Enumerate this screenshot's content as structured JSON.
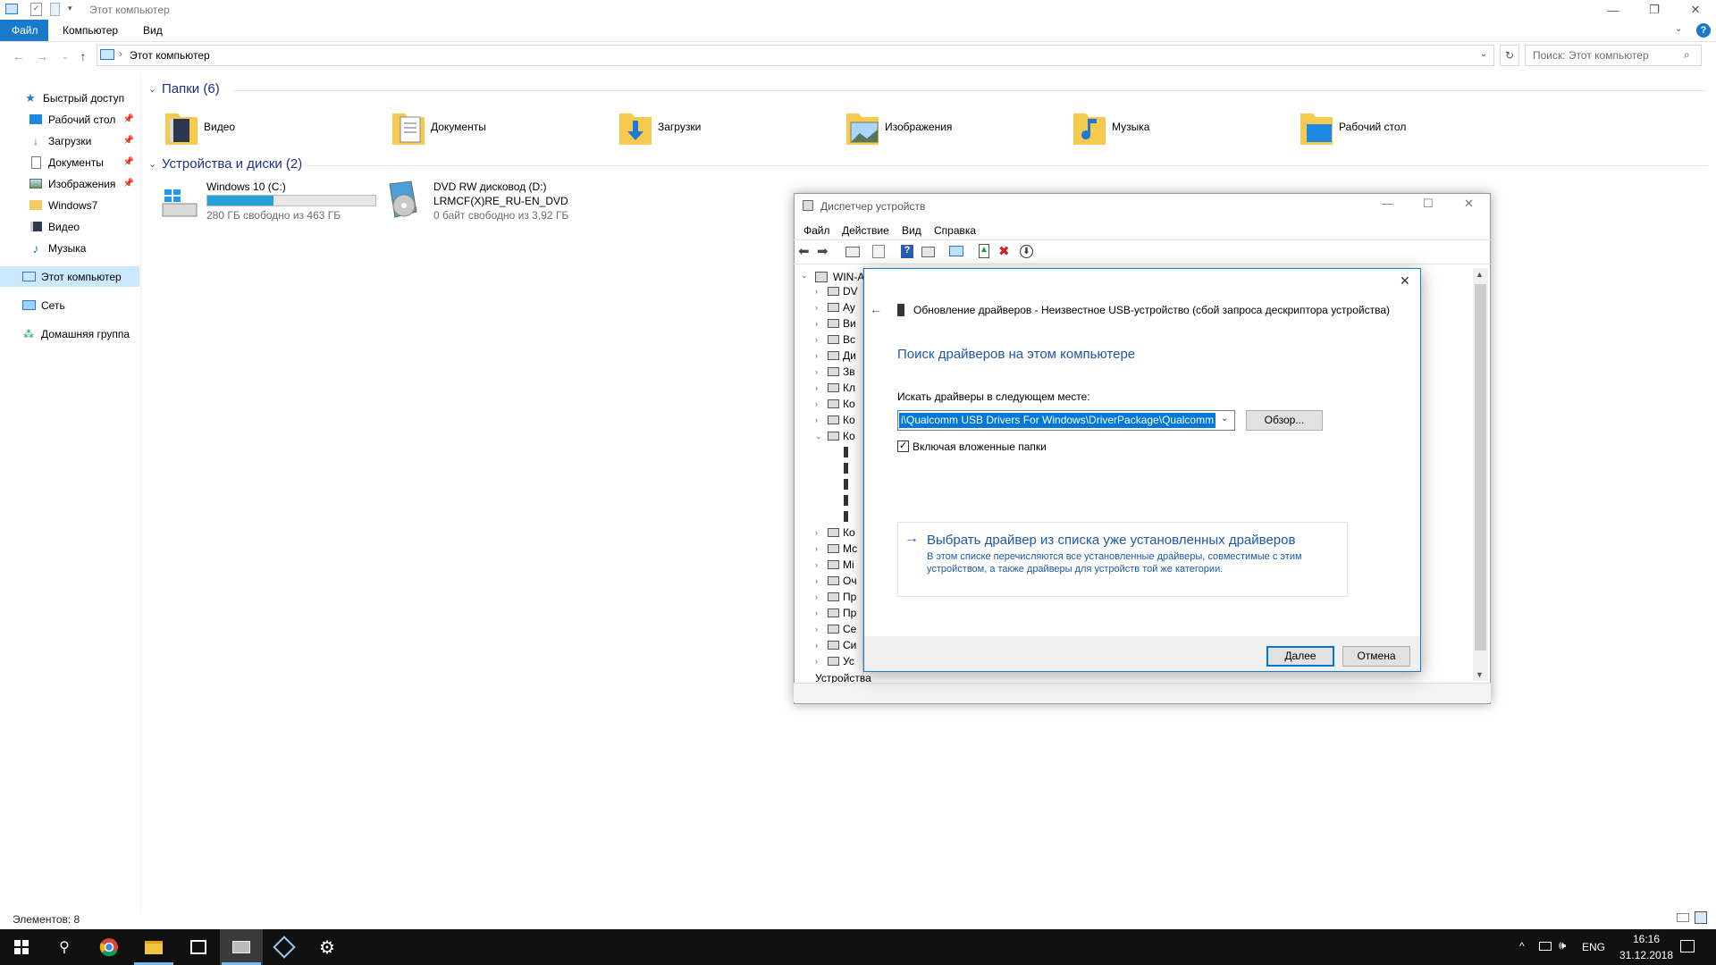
{
  "explorer": {
    "title": "Этот компьютер",
    "ribbon_tabs": [
      "Файл",
      "Компьютер",
      "Вид"
    ],
    "address": "Этот компьютер",
    "search_placeholder": "Поиск: Этот компьютер",
    "sidebar": [
      {
        "label": "Быстрый доступ",
        "icon": "star-icon",
        "color": "#2b79d4"
      },
      {
        "label": "Рабочий стол",
        "icon": "desktop-icon",
        "pinned": true
      },
      {
        "label": "Загрузки",
        "icon": "downloads-icon",
        "pinned": true
      },
      {
        "label": "Документы",
        "icon": "documents-icon",
        "pinned": true
      },
      {
        "label": "Изображения",
        "icon": "pictures-icon",
        "pinned": true
      },
      {
        "label": "Windows7",
        "icon": "folder-icon"
      },
      {
        "label": "Видео",
        "icon": "video-icon"
      },
      {
        "label": "Музыка",
        "icon": "music-icon"
      },
      {
        "label": "Этот компьютер",
        "icon": "computer-icon",
        "selected": true
      },
      {
        "label": "Сеть",
        "icon": "network-icon"
      },
      {
        "label": "Домашняя группа",
        "icon": "homegroup-icon"
      }
    ],
    "folders_header": "Папки (6)",
    "folders": [
      "Видео",
      "Документы",
      "Загрузки",
      "Изображения",
      "Музыка",
      "Рабочий стол"
    ],
    "devices_header": "Устройства и диски (2)",
    "drives": [
      {
        "name": "Windows 10 (C:)",
        "free": "280 ГБ свободно из 463 ГБ",
        "used_fraction": 0.395
      },
      {
        "name": "DVD RW дисковод (D:)",
        "label": "LRMCF(X)RE_RU-EN_DVD",
        "free": "0 байт свободно из 3,92 ГБ"
      }
    ],
    "status": "Элементов: 8"
  },
  "device_manager": {
    "title": "Диспетчер устройств",
    "menu": [
      "Файл",
      "Действие",
      "Вид",
      "Справка"
    ],
    "tree_root": "WIN-A",
    "tree_items": [
      "DV",
      "Ау",
      "Ви",
      "Вс",
      "Ди",
      "Зв",
      "Кл",
      "Ко",
      "Ко",
      "Ко",
      "",
      "",
      "",
      "",
      "",
      "Ко",
      "Мс",
      "Мі",
      "Оч",
      "Пр",
      "Пр",
      "Се",
      "Си",
      "Ус"
    ],
    "bottom_item": "Устройства обработки изображений"
  },
  "dialog": {
    "title": "Обновление драйверов - Неизвестное USB-устройство (сбой запроса дескриптора устройства)",
    "heading": "Поиск драйверов на этом компьютере",
    "search_label": "Искать драйверы в следующем месте:",
    "path_value": "i\\Qualcomm USB Drivers For Windows\\DriverPackage\\Qualcomm",
    "browse": "Обзор...",
    "include_subfolders": "Включая вложенные папки",
    "link_title": "Выбрать драйвер из списка уже установленных драйверов",
    "link_desc_1": "В этом списке перечисляются все установленные драйверы, совместимые с этим",
    "link_desc_2": "устройством, а также драйверы для устройств той же категории.",
    "next": "Далее",
    "cancel": "Отмена"
  },
  "taskbar": {
    "lang": "ENG",
    "time": "16:16",
    "date": "31.12.2018"
  }
}
